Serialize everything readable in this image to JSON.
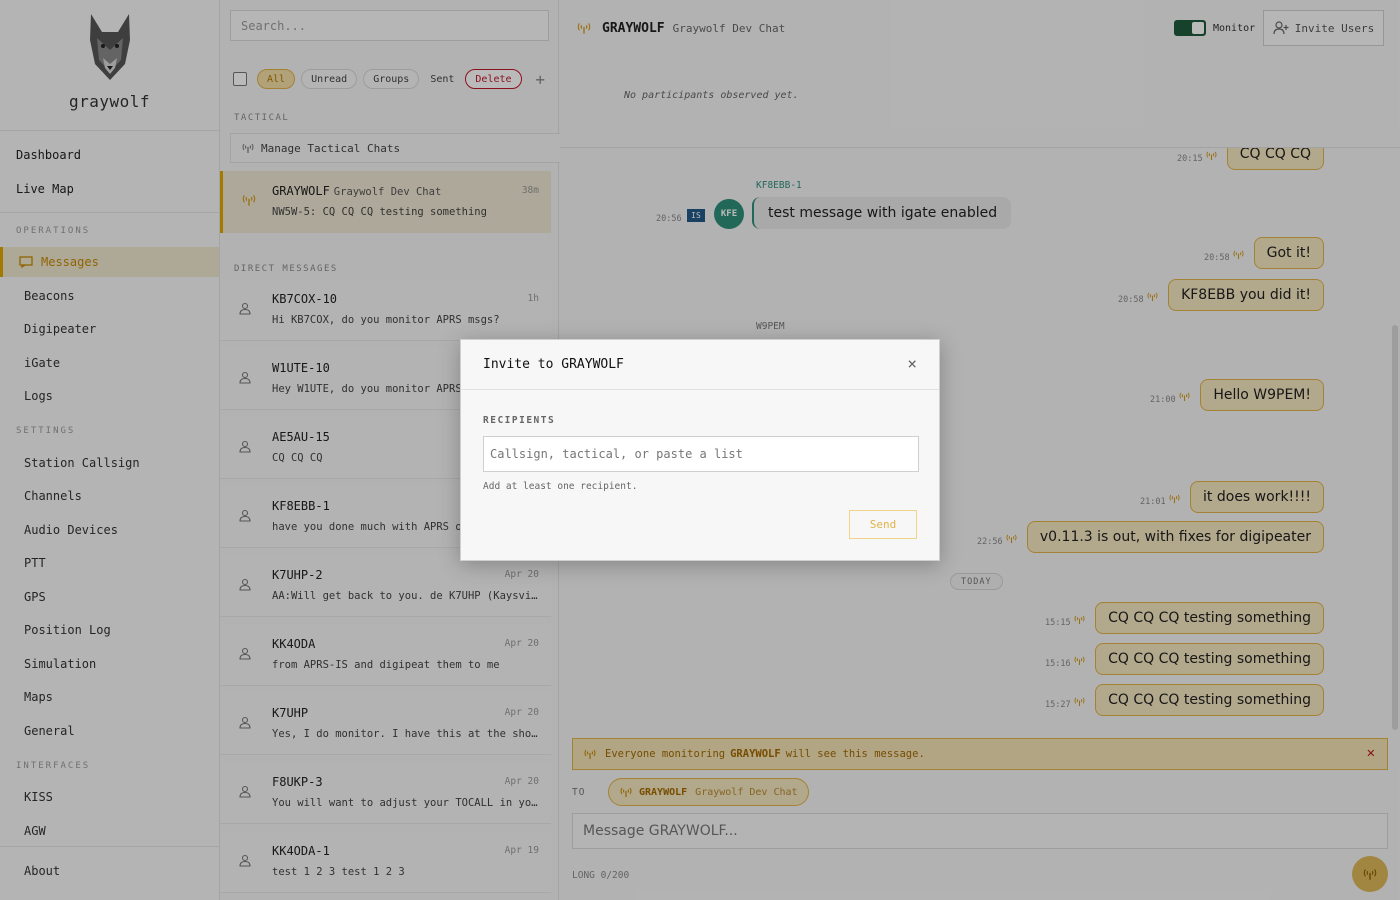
{
  "app": {
    "name": "graywolf"
  },
  "sidebar": {
    "top_items": [
      {
        "label": "Dashboard"
      },
      {
        "label": "Live Map"
      }
    ],
    "sections": {
      "operations": "OPERATIONS",
      "settings": "SETTINGS",
      "interfaces": "INTERFACES"
    },
    "operations_items": [
      {
        "label": "Messages",
        "active": true
      },
      {
        "label": "Beacons"
      },
      {
        "label": "Digipeater"
      },
      {
        "label": "iGate"
      },
      {
        "label": "Logs"
      }
    ],
    "settings_items": [
      {
        "label": "Station Callsign"
      },
      {
        "label": "Channels"
      },
      {
        "label": "Audio Devices"
      },
      {
        "label": "PTT"
      },
      {
        "label": "GPS"
      },
      {
        "label": "Position Log"
      },
      {
        "label": "Simulation"
      },
      {
        "label": "Maps"
      },
      {
        "label": "General"
      }
    ],
    "interfaces_items": [
      {
        "label": "KISS"
      },
      {
        "label": "AGW"
      }
    ],
    "about": "About"
  },
  "list": {
    "search_placeholder": "Search...",
    "filters": [
      "All",
      "Unread",
      "Groups",
      "Sent",
      "Delete"
    ],
    "plus": "+",
    "tactical_heading": "TACTICAL",
    "manage_tactical": "Manage Tactical Chats",
    "tactical_items": [
      {
        "title": "GRAYWOLF",
        "subtitle": "Graywolf Dev Chat",
        "time": "38m",
        "preview": "NW5W-5: CQ CQ CQ testing something"
      }
    ],
    "dm_heading": "DIRECT MESSAGES",
    "dm_items": [
      {
        "title": "KB7COX-10",
        "time": "1h",
        "preview": "Hi KB7COX, do you monitor APRS msgs?"
      },
      {
        "title": "W1UTE-10",
        "time": "",
        "preview": "Hey W1UTE, do you monitor APRS"
      },
      {
        "title": "AE5AU-15",
        "time": "",
        "preview": "CQ CQ CQ"
      },
      {
        "title": "KF8EBB-1",
        "time": "",
        "preview": "have you done much with APRS on"
      },
      {
        "title": "K7UHP-2",
        "time": "Apr 20",
        "preview": "AA:Will get back to you. de K7UHP (Kaysvill…"
      },
      {
        "title": "KK4ODA",
        "time": "Apr 20",
        "preview": "from APRS-IS and digipeat them to me"
      },
      {
        "title": "K7UHP",
        "time": "Apr 20",
        "preview": "Yes, I do monitor. I have this at the shop …"
      },
      {
        "title": "F8UKP-3",
        "time": "Apr 20",
        "preview": "You will want to adjust your TOCALL in your…"
      },
      {
        "title": "KK4ODA-1",
        "time": "Apr 19",
        "preview": "test 1 2 3 test 1 2 3"
      }
    ]
  },
  "chat": {
    "title": "GRAYWOLF",
    "subtitle": "Graywolf Dev Chat",
    "monitor_label": "Monitor",
    "invite_label": "Invite Users",
    "participants": "No participants observed yet.",
    "messages_out": [
      {
        "time": "20:15",
        "text": "CQ CQ CQ"
      },
      {
        "time": "20:58",
        "text": "Got it!"
      },
      {
        "time": "20:58",
        "text": "KF8EBB you did it!"
      },
      {
        "time": "21:00",
        "text": "Hello W9PEM!"
      },
      {
        "time": "21:01",
        "text": "it does work!!!!"
      },
      {
        "time": "22:56",
        "text": "v0.11.3 is out, with fixes for digipeater"
      },
      {
        "time": "15:15",
        "text": "CQ CQ CQ testing something"
      },
      {
        "time": "15:16",
        "text": "CQ CQ CQ testing something"
      },
      {
        "time": "15:27",
        "text": "CQ CQ CQ testing something"
      }
    ],
    "incoming": {
      "sender": "KF8EBB-1",
      "time": "20:56",
      "badge": "IS",
      "avatar": "KFE",
      "text": "test message with igate enabled"
    },
    "sender2": "W9PEM",
    "today": "TODAY",
    "warning": {
      "prefix": "Everyone monitoring",
      "name": "GRAYWOLF",
      "suffix": "will see this message."
    },
    "to_label": "TO",
    "to_chip_name": "GRAYWOLF",
    "to_chip_sub": "Graywolf Dev Chat",
    "compose_placeholder": "Message GRAYWOLF...",
    "counter": "LONG 0/200"
  },
  "modal": {
    "title": "Invite to GRAYWOLF",
    "recipients_label": "RECIPIENTS",
    "input_placeholder": "Callsign, tactical, or paste a list",
    "hint": "Add at least one recipient.",
    "send_label": "Send",
    "close": "×"
  },
  "colors": {
    "accent": "#e0a800",
    "toggle_on": "#1f5a3a",
    "danger": "#c0182b",
    "igate_badge": "#225a88",
    "avatar": "#2f8f7a"
  }
}
